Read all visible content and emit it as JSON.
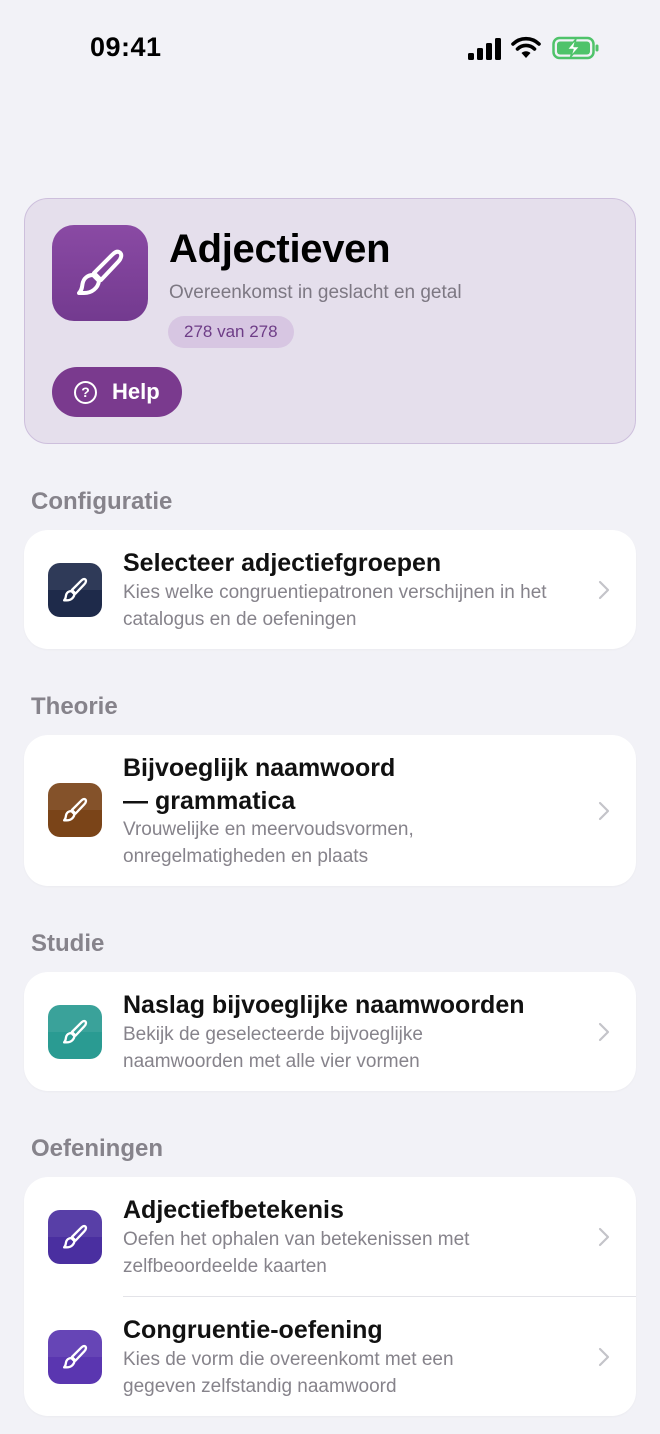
{
  "status_bar": {
    "time": "09:41"
  },
  "hero": {
    "title": "Adjectieven",
    "subtitle": "Overeenkomst in geslacht en getal",
    "badge": "278 van 278",
    "help_label": "Help",
    "icon": "paintbrush-icon",
    "accent_color": "#7a3a8e"
  },
  "sections": {
    "configuration": {
      "header": "Configuratie",
      "items": [
        {
          "title": "Selecteer adjectiefgroepen",
          "description": "Kies welke congruentiepatronen verschijnen in het catalogus en de oefeningen",
          "icon": "paintbrush-icon",
          "color": "#1e2a4a"
        }
      ]
    },
    "theory": {
      "header": "Theorie",
      "items": [
        {
          "title": "Bijvoeglijk naamwoord — grammatica",
          "description": "Vrouwelijke en meervoudsvormen, onregelmatigheden en plaats",
          "icon": "paintbrush-icon",
          "color": "#7a4418"
        }
      ]
    },
    "study": {
      "header": "Studie",
      "items": [
        {
          "title": "Naslag bijvoeglijke naamwoorden",
          "description": "Bekijk de geselecteerde bijvoeglijke naamwoorden met alle vier vormen",
          "icon": "paintbrush-icon",
          "color": "#2a9b92"
        }
      ]
    },
    "exercises": {
      "header": "Oefeningen",
      "items": [
        {
          "title": "Adjectiefbetekenis",
          "description": "Oefen het ophalen van betekenissen met zelfbeoordeelde kaarten",
          "icon": "paintbrush-icon",
          "color": "#4a2fa0"
        },
        {
          "title": "Congruentie-oefening",
          "description": "Kies de vorm die overeenkomt met een gegeven zelfstandig naamwoord",
          "icon": "paintbrush-icon",
          "color": "#5a36b0"
        }
      ]
    }
  }
}
